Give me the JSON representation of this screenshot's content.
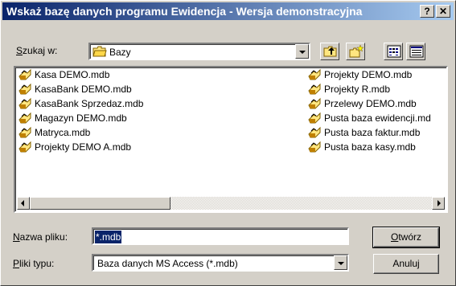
{
  "window": {
    "title": "Wskaż bazę danych programu Ewidencja - Wersja demonstracyjna",
    "help_label": "?",
    "close_label": "✕"
  },
  "look_in": {
    "label": "Szukaj w:",
    "value": "Bazy"
  },
  "toolbar": {
    "icons": [
      "up-folder-icon",
      "new-folder-icon",
      "list-view-icon",
      "details-view-icon"
    ]
  },
  "files": {
    "column1": [
      "Kasa DEMO.mdb",
      "KasaBank DEMO.mdb",
      "KasaBank Sprzedaz.mdb",
      "Magazyn DEMO.mdb",
      "Matryca.mdb",
      "Projekty DEMO A.mdb"
    ],
    "column2": [
      "Projekty DEMO.mdb",
      "Projekty R.mdb",
      "Przelewy DEMO.mdb",
      "Pusta baza ewidencji.md",
      "Pusta baza faktur.mdb",
      "Pusta baza kasy.mdb"
    ]
  },
  "filename": {
    "label": "Nazwa pliku:",
    "value": "*.mdb"
  },
  "filetype": {
    "label": "Pliki typu:",
    "value": "Baza danych MS Access (*.mdb)"
  },
  "buttons": {
    "open": "Otwórz",
    "cancel": "Anuluj"
  },
  "colors": {
    "title_start": "#0a246a",
    "title_end": "#a6caf0",
    "face": "#d4d0c8"
  }
}
